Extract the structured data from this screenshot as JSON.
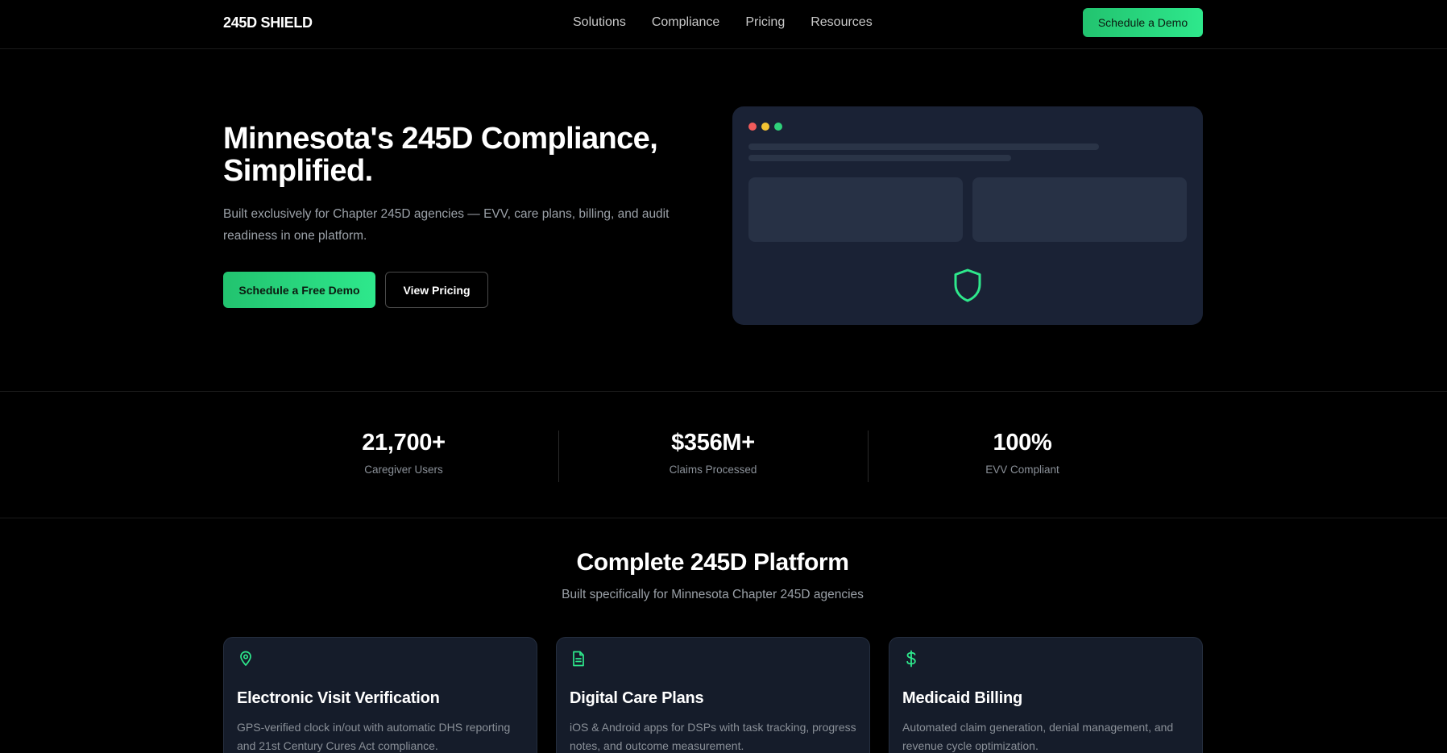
{
  "brand": {
    "logo": "245D SHIELD",
    "accent": "#2ee88c",
    "background": "#000000",
    "card_background": "#151c2a"
  },
  "nav": {
    "links": [
      "Solutions",
      "Compliance",
      "Pricing",
      "Resources"
    ],
    "cta": "Schedule a Demo"
  },
  "hero": {
    "title": "Minnesota's 245D Compliance, Simplified.",
    "subtitle": "Built exclusively for Chapter 245D agencies — EVV, care plans, billing, and audit readiness in one platform.",
    "primary_button": "Schedule a Free Demo",
    "secondary_button": "View Pricing",
    "mock_icon": "shield-icon"
  },
  "stats": [
    {
      "value": "21,700+",
      "label": "Caregiver Users"
    },
    {
      "value": "$356M+",
      "label": "Claims Processed"
    },
    {
      "value": "100%",
      "label": "EVV Compliant"
    }
  ],
  "features": {
    "title": "Complete 245D Platform",
    "subtitle": "Built specifically for Minnesota Chapter 245D agencies",
    "cards": [
      {
        "icon": "location-pin-icon",
        "title": "Electronic Visit Verification",
        "description": "GPS-verified clock in/out with automatic DHS reporting and 21st Century Cures Act compliance."
      },
      {
        "icon": "document-icon",
        "title": "Digital Care Plans",
        "description": "iOS & Android apps for DSPs with task tracking, progress notes, and outcome measurement."
      },
      {
        "icon": "dollar-icon",
        "title": "Medicaid Billing",
        "description": "Automated claim generation, denial management, and revenue cycle optimization."
      }
    ]
  }
}
